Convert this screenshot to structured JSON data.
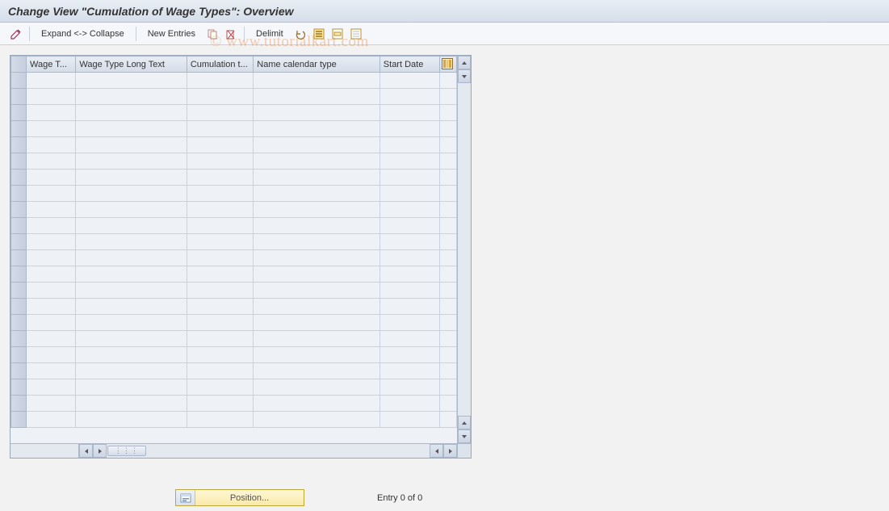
{
  "title": "Change View \"Cumulation of Wage Types\": Overview",
  "toolbar": {
    "expand_collapse": "Expand <-> Collapse",
    "new_entries": "New Entries",
    "delimit": "Delimit"
  },
  "icons": {
    "pencil": "pencil-icon",
    "copy": "copy-icon",
    "delete": "delete-icon",
    "undo": "undo-icon",
    "select_all": "select-all-icon",
    "select_block": "select-block-icon",
    "deselect_all": "deselect-all-icon",
    "table_config": "table-settings-icon"
  },
  "table": {
    "columns": [
      "Wage T...",
      "Wage Type Long Text",
      "Cumulation t...",
      "Name calendar type",
      "Start Date"
    ],
    "row_count": 22,
    "rows": []
  },
  "footer": {
    "position_label": "Position...",
    "entry_text": "Entry 0 of 0"
  },
  "watermark": "© www.tutorialkart.com",
  "colors": {
    "header_grad_top": "#e8eef5",
    "header_grad_bottom": "#d5deea",
    "border": "#abb8cc",
    "cell_bg": "#eef2f7"
  }
}
